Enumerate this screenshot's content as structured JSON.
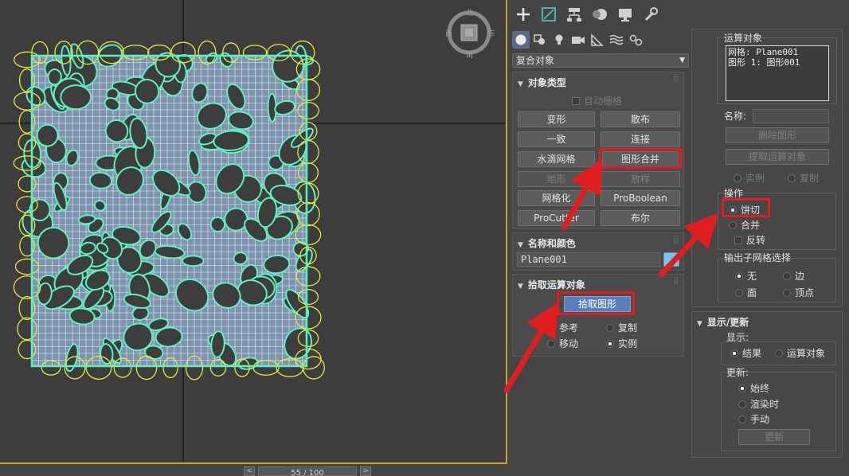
{
  "colors": {
    "accent": "#5b7fba",
    "highlight": "#e01e1e",
    "object_color": "#6fc9f0",
    "mesh_outline": "#5ef0c0",
    "shape_outline": "#e6e83a"
  },
  "viewport": {
    "viewcube": {
      "top": "北",
      "bottom": "南",
      "left": "西",
      "right": "东"
    },
    "frame": "55 / 100"
  },
  "toolbar": {
    "tabs": [
      {
        "icon": "plus-icon"
      },
      {
        "icon": "modify-icon"
      },
      {
        "icon": "hierarchy-icon"
      },
      {
        "icon": "motion-icon"
      },
      {
        "icon": "display-icon"
      },
      {
        "icon": "utilities-icon"
      }
    ]
  },
  "create": {
    "categories": [
      "geometry-icon",
      "shapes-icon",
      "lights-icon",
      "cameras-icon",
      "helpers-icon",
      "spacewarps-icon",
      "systems-icon"
    ],
    "dropdown": "复合对象"
  },
  "object_type": {
    "title": "对象类型",
    "autogrid": "自动栅格",
    "buttons": [
      "变形",
      "散布",
      "一致",
      "连接",
      "水滴网格",
      "图形合并",
      "地形",
      "放样",
      "网格化",
      "ProBoolean",
      "ProCutter",
      "布尔"
    ]
  },
  "name_color": {
    "title": "名称和颜色",
    "name": "Plane001"
  },
  "pick_operand": {
    "title": "拾取运算对象",
    "pick_button": "拾取图形",
    "options": [
      "参考",
      "复制",
      "移动",
      "实例"
    ]
  },
  "operands": {
    "title": "运算对象",
    "list": [
      "网格: Plane001",
      "图形 1: 图形001"
    ],
    "name_label": "名称:",
    "delete_button": "删除图形",
    "extract_button": "提取运算对象",
    "instance": "实例",
    "copy": "复制"
  },
  "operations": {
    "title": "操作",
    "cookie_cutter": "饼切",
    "merge": "合并",
    "invert": "反转"
  },
  "output_sub_mesh": {
    "title": "输出子网格选择",
    "none": "无",
    "edge": "边",
    "face": "面",
    "vertex": "顶点"
  },
  "display_update": {
    "title": "显示/更新",
    "display_label": "显示:",
    "result": "结果",
    "operands": "运算对象",
    "update_label": "更新:",
    "always": "始终",
    "when_rendering": "渲染时",
    "manually": "手动",
    "update_button": "更新"
  }
}
